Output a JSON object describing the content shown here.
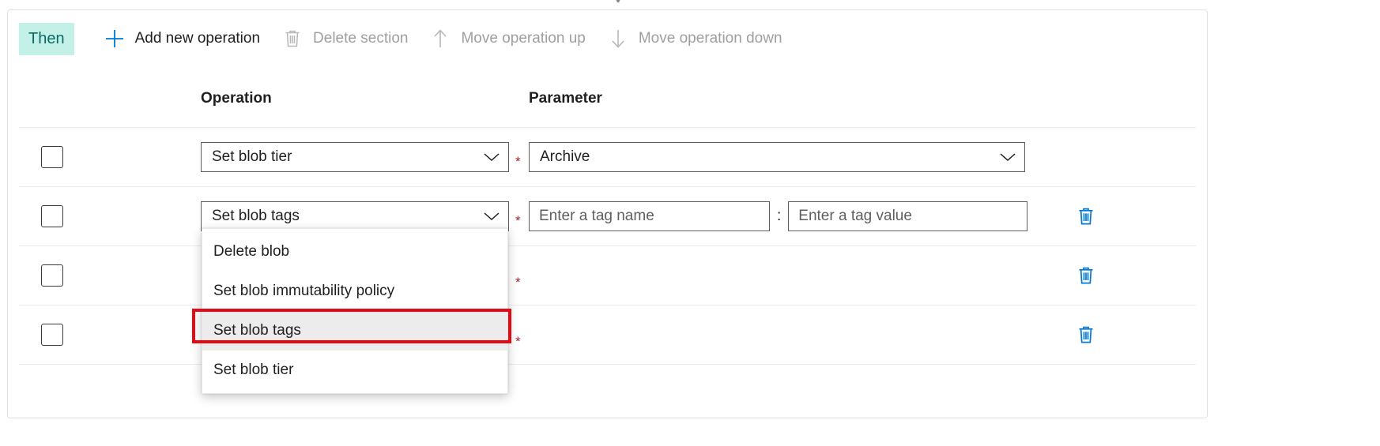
{
  "section": {
    "badge_label": "Then"
  },
  "toolbar": {
    "items": [
      {
        "label": "Add new operation",
        "icon": "plus-icon",
        "enabled": true
      },
      {
        "label": "Delete section",
        "icon": "trash-icon",
        "enabled": false
      },
      {
        "label": "Move operation up",
        "icon": "arrow-up-icon",
        "enabled": false
      },
      {
        "label": "Move operation down",
        "icon": "arrow-down-icon",
        "enabled": false
      }
    ]
  },
  "grid": {
    "columns": {
      "select": "",
      "operation": "Operation",
      "parameter": "Parameter"
    },
    "rows": [
      {
        "checked": false,
        "operation": "Set blob tier",
        "required": "*",
        "param_type": "select",
        "param_value": "Archive",
        "has_delete": false
      },
      {
        "checked": false,
        "operation": "Set blob tags",
        "required": "*",
        "param_type": "tag-pair",
        "tag_name_placeholder": "Enter a tag name",
        "tag_value_placeholder": "Enter a tag value",
        "separator": ":",
        "has_delete": true
      },
      {
        "checked": false,
        "operation": "",
        "required": "*",
        "param_type": "hidden",
        "has_delete": true
      },
      {
        "checked": false,
        "operation": "",
        "required": "*",
        "param_type": "hidden",
        "has_delete": true
      }
    ]
  },
  "dropdown": {
    "open": true,
    "selected": "Set blob tags",
    "options": [
      "Delete blob",
      "Set blob immutability policy",
      "Set blob tags",
      "Set blob tier"
    ]
  },
  "colors": {
    "badge_bg": "#c3f1e8",
    "badge_fg": "#0b6a64",
    "accent": "#0078d4",
    "required_star": "#a4262c",
    "highlight_box": "#e50914",
    "disabled_text": "#a19f9d",
    "selected_item_bg": "#ececec"
  },
  "icons": {
    "plus": "plus-icon",
    "trash": "trash-icon",
    "arrow_up": "arrow-up-icon",
    "arrow_down": "arrow-down-icon",
    "chevron_down": "chevron-down-icon",
    "top_chevron": "chevron-down-icon"
  }
}
